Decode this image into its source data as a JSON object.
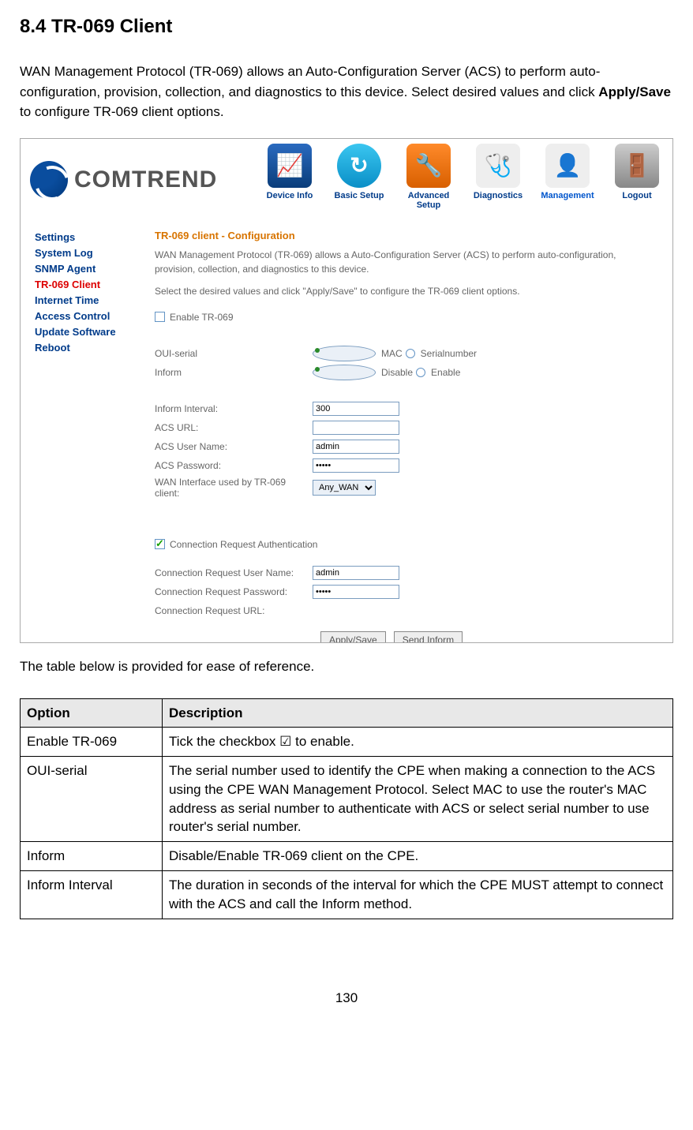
{
  "heading": "8.4 TR-069 Client",
  "intro_a": "WAN Management Protocol (TR-069) allows an Auto-Configuration Server (ACS) to perform auto-configuration, provision, collection, and diagnostics to this device. Select desired values and click ",
  "intro_b": "Apply/Save",
  "intro_c": " to configure TR-069 client options.",
  "logo": "COMTREND",
  "nav": {
    "dev": "Device Info",
    "basic": "Basic Setup",
    "adv": "Advanced Setup",
    "diag": "Diagnostics",
    "mgt": "Management",
    "logout": "Logout"
  },
  "sidebar": {
    "settings": "Settings",
    "syslog": "System Log",
    "snmp": "SNMP Agent",
    "tr069": "TR-069 Client",
    "itime": "Internet Time",
    "access": "Access Control",
    "update": "Update Software",
    "reboot": "Reboot"
  },
  "panel": {
    "title": "TR-069 client - Configuration",
    "desc1": "WAN Management Protocol (TR-069) allows a Auto-Configuration Server (ACS) to perform auto-configuration, provision, collection, and diagnostics to this device.",
    "desc2": "Select the desired values and click \"Apply/Save\" to configure the TR-069 client options.",
    "enable": "Enable TR-069",
    "oui": "OUI-serial",
    "mac": "MAC",
    "serialnum": "Serialnumber",
    "inform": "Inform",
    "disable": "Disable",
    "enable_r": "Enable",
    "interval_l": "Inform Interval:",
    "interval_v": "300",
    "acsurl_l": "ACS URL:",
    "acsurl_v": "",
    "acsuser_l": "ACS User Name:",
    "acsuser_v": "admin",
    "acspw_l": "ACS Password:",
    "acspw_v": "•••••",
    "wanif_l": "WAN Interface used by TR-069 client:",
    "wanif_v": "Any_WAN",
    "connreq_chk": "Connection Request Authentication",
    "cruser_l": "Connection Request User Name:",
    "cruser_v": "admin",
    "crpw_l": "Connection Request Password:",
    "crpw_v": "•••••",
    "crurl_l": "Connection Request URL:",
    "crurl_v": "",
    "btn_apply": "Apply/Save",
    "btn_send": "Send Inform"
  },
  "after_text": "The table below is provided for ease of reference.",
  "ref": {
    "h_opt": "Option",
    "h_desc": "Description",
    "r1o": "Enable TR-069",
    "r1d": "Tick the checkbox ☑ to enable.",
    "r2o": "OUI-serial",
    "r2d": "The serial number used to identify the CPE when making a connection to the ACS using the CPE WAN Management Protocol.  Select MAC to use the router's MAC address as serial number to authenticate with ACS or select serial number to use router's serial number.",
    "r3o": "Inform",
    "r3d": "Disable/Enable TR-069 client on the CPE.",
    "r4o": "Inform Interval",
    "r4d": "The duration in seconds of the interval for which the CPE MUST attempt to connect with the ACS and call the Inform method."
  },
  "pagenum": "130"
}
